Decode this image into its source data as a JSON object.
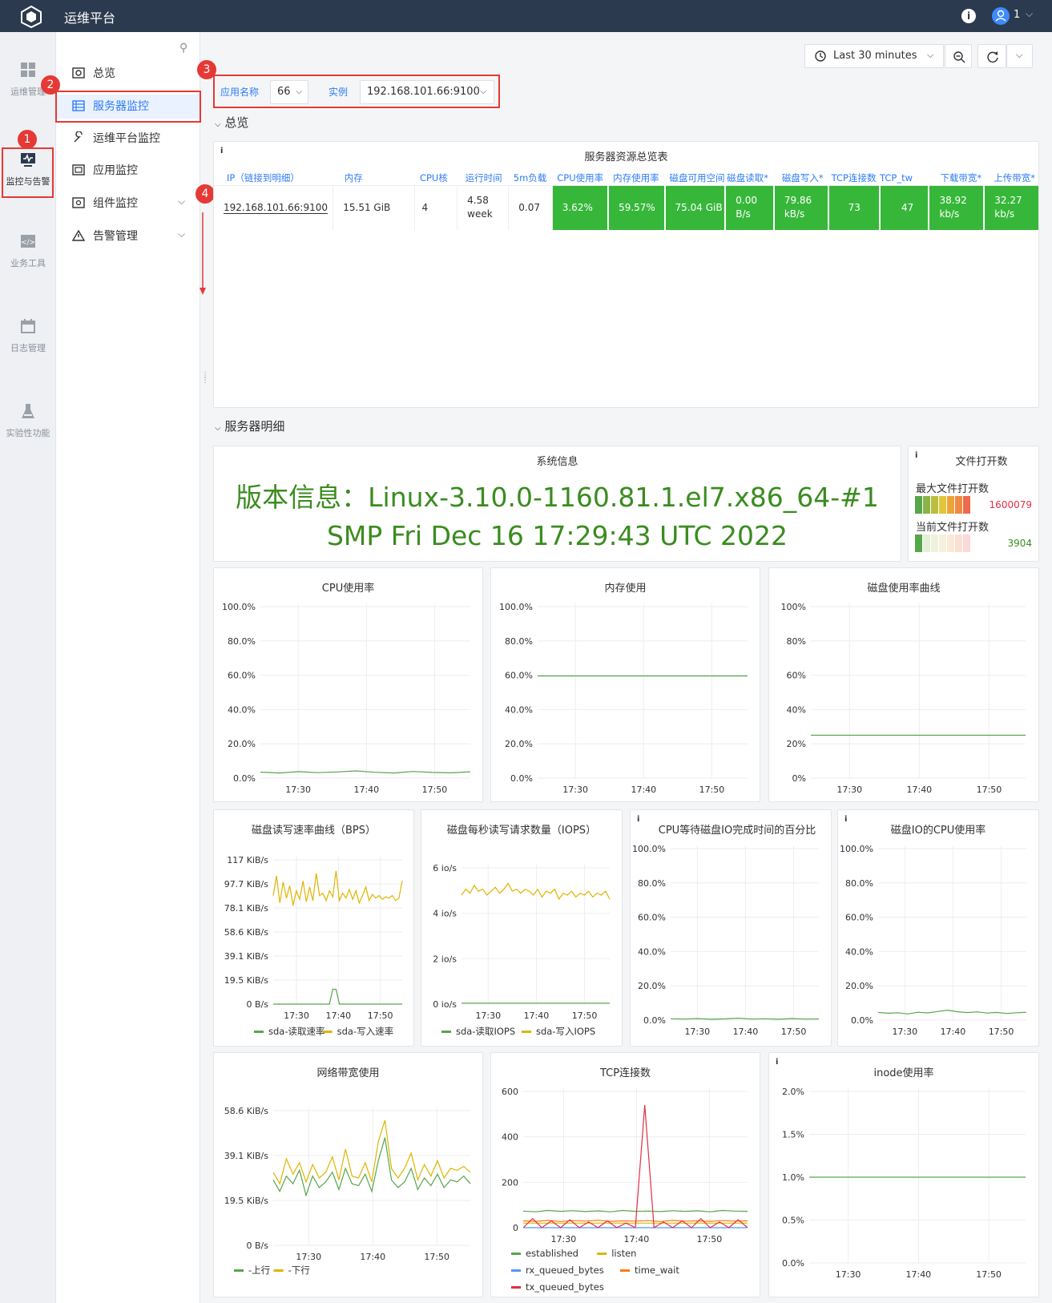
{
  "app": {
    "title": "运维平台",
    "user": "1"
  },
  "rail": [
    {
      "label": "运维管理",
      "icon": "grid-icon"
    },
    {
      "label": "监控与告警",
      "icon": "monitor-icon"
    },
    {
      "label": "业务工具",
      "icon": "code-icon"
    },
    {
      "label": "日志管理",
      "icon": "calendar-icon"
    },
    {
      "label": "实验性功能",
      "icon": "flask-icon"
    }
  ],
  "menu": [
    {
      "label": "总览",
      "icon": "dashboard-icon"
    },
    {
      "label": "服务器监控",
      "icon": "server-list-icon"
    },
    {
      "label": "运维平台监控",
      "icon": "wrench-icon"
    },
    {
      "label": "应用监控",
      "icon": "app-icon"
    },
    {
      "label": "组件监控",
      "icon": "component-icon"
    },
    {
      "label": "告警管理",
      "icon": "alert-icon"
    }
  ],
  "annotations": [
    "1",
    "2",
    "3",
    "4"
  ],
  "time_picker": {
    "label": "Last 30 minutes"
  },
  "filters": {
    "app_label": "应用名称",
    "app_value": "66",
    "instance_label": "实例",
    "instance_value": "192.168.101.66:9100"
  },
  "sections": {
    "overview": "总览",
    "detail": "服务器明细"
  },
  "overview_table": {
    "title": "服务器资源总览表",
    "headers": [
      "IP（链接到明细）",
      "内存",
      "CPU核",
      "运行时间",
      "5m负载",
      "CPU使用率",
      "内存使用率",
      "磁盘可用空间",
      "磁盘读取*",
      "磁盘写入*",
      "TCP连接数",
      "TCP_tw",
      "下载带宽*",
      "上传带宽*"
    ],
    "row": [
      "192.168.101.66:9100",
      "15.51 GiB",
      "4",
      "4.58 week",
      "0.07",
      "3.62%",
      "59.57%",
      "75.04 GiB",
      "0.00 B/s",
      "79.86 kB/s",
      "73",
      "47",
      "38.92 kb/s",
      "32.27 kb/s"
    ]
  },
  "sysinfo": {
    "title": "系统信息",
    "text": "版本信息：Linux-3.10.0-1160.81.1.el7.x86_64-#1 SMP Fri Dec 16 17:29:43 UTC 2022"
  },
  "files": {
    "title": "文件打开数",
    "max_label": "最大文件打开数",
    "max_value": "1600079",
    "cur_label": "当前文件打开数",
    "cur_value": "3904"
  },
  "colors": {
    "green": "#56a64b",
    "yellow": "#e0b400",
    "blue": "#5794f2",
    "orange": "#ff780a",
    "red": "#e02f44",
    "cell_green": "#37b73a"
  },
  "charts": [
    {
      "title": "CPU使用率",
      "yticks": [
        "100.0%",
        "80.0%",
        "60.0%",
        "40.0%",
        "20.0%",
        "0.0%"
      ],
      "xticks": [
        "17:30",
        "17:40",
        "17:50"
      ]
    },
    {
      "title": "内存使用",
      "yticks": [
        "100.0%",
        "80.0%",
        "60.0%",
        "40.0%",
        "20.0%",
        "0.0%"
      ],
      "xticks": [
        "17:30",
        "17:40",
        "17:50"
      ]
    },
    {
      "title": "磁盘使用率曲线",
      "yticks": [
        "100%",
        "80%",
        "60%",
        "40%",
        "20%",
        "0%"
      ],
      "xticks": [
        "17:30",
        "17:40",
        "17:50"
      ]
    },
    {
      "title": "磁盘读写速率曲线（BPS）",
      "yticks": [
        "117 KiB/s",
        "97.7 KiB/s",
        "78.1 KiB/s",
        "58.6 KiB/s",
        "39.1 KiB/s",
        "19.5 KiB/s",
        "0 B/s"
      ],
      "xticks": [
        "17:30",
        "17:40",
        "17:50"
      ],
      "legend": [
        "sda-读取速率",
        "sda-写入速率"
      ]
    },
    {
      "title": "磁盘每秒读写请求数量（IOPS）",
      "yticks": [
        "6 io/s",
        "4 io/s",
        "2 io/s",
        "0 io/s"
      ],
      "xticks": [
        "17:30",
        "17:40",
        "17:50"
      ],
      "legend": [
        "sda-读取IOPS",
        "sda-写入IOPS"
      ]
    },
    {
      "title": "CPU等待磁盘IO完成时间的百分比",
      "yticks": [
        "100.0%",
        "80.0%",
        "60.0%",
        "40.0%",
        "20.0%",
        "0.0%"
      ],
      "xticks": [
        "17:30",
        "17:40",
        "17:50"
      ]
    },
    {
      "title": "磁盘IO的CPU使用率",
      "yticks": [
        "100.0%",
        "80.0%",
        "60.0%",
        "40.0%",
        "20.0%",
        "0.0%"
      ],
      "xticks": [
        "17:30",
        "17:40",
        "17:50"
      ]
    },
    {
      "title": "网络带宽使用",
      "yticks": [
        "58.6 KiB/s",
        "39.1 KiB/s",
        "19.5 KiB/s",
        "0 B/s"
      ],
      "xticks": [
        "17:30",
        "17:40",
        "17:50"
      ],
      "legend": [
        "-上行",
        "-下行"
      ]
    },
    {
      "title": "TCP连接数",
      "yticks": [
        "600",
        "400",
        "200",
        "0"
      ],
      "xticks": [
        "17:30",
        "17:40",
        "17:50"
      ],
      "legend": [
        "established",
        "listen",
        "rx_queued_bytes",
        "time_wait",
        "tx_queued_bytes"
      ]
    },
    {
      "title": "inode使用率",
      "yticks": [
        "2.0%",
        "1.5%",
        "1.0%",
        "0.5%",
        "0.0%"
      ],
      "xticks": [
        "17:30",
        "17:40",
        "17:50"
      ]
    }
  ],
  "chart_data": [
    {
      "type": "line",
      "title": "CPU使用率",
      "ylim": [
        0,
        100
      ],
      "x": [
        "17:22",
        "17:52"
      ],
      "series": [
        {
          "values": [
            3.5,
            3.0,
            3.8,
            3.2,
            3.6,
            4.2,
            3.4,
            3.0,
            3.9,
            3.3,
            3.1,
            3.7
          ]
        }
      ]
    },
    {
      "type": "line",
      "title": "内存使用",
      "ylim": [
        0,
        100
      ],
      "x": [
        "17:22",
        "17:52"
      ],
      "series": [
        {
          "values": [
            59.6,
            59.6
          ]
        }
      ]
    },
    {
      "type": "line",
      "title": "磁盘使用率曲线",
      "ylim": [
        0,
        100
      ],
      "x": [
        "17:22",
        "17:52"
      ],
      "series": [
        {
          "values": [
            25,
            25
          ]
        }
      ]
    },
    {
      "type": "line",
      "title": "磁盘读写速率曲线（BPS）",
      "ylim": [
        0,
        117
      ],
      "legend": "bottom",
      "series": [
        {
          "name": "sda-读取速率",
          "values": [
            0,
            0,
            0,
            0,
            0,
            0,
            0,
            0,
            0,
            0,
            0,
            0,
            0,
            0,
            0,
            0,
            0,
            0,
            12,
            12,
            0,
            0,
            0,
            0,
            0,
            0,
            0,
            0,
            0,
            0,
            0,
            0,
            0,
            0,
            0,
            0,
            0,
            0,
            0,
            0
          ]
        },
        {
          "name": "sda-写入速率",
          "values": [
            88,
            104,
            82,
            99,
            86,
            96,
            80,
            92,
            85,
            100,
            83,
            95,
            84,
            106,
            88,
            90,
            84,
            92,
            87,
            108,
            84,
            90,
            86,
            93,
            85,
            92,
            82,
            88,
            95,
            84,
            89,
            86,
            88,
            85,
            87,
            86,
            88,
            84,
            86,
            100
          ]
        }
      ]
    },
    {
      "type": "line",
      "title": "磁盘每秒读写请求数量（IOPS）",
      "ylim": [
        0,
        7
      ],
      "legend": "bottom",
      "series": [
        {
          "name": "sda-读取IOPS",
          "values": [
            0.05,
            0.05
          ]
        },
        {
          "name": "sda-写入IOPS",
          "values": [
            5.6,
            5.9,
            5.7,
            6.1,
            5.8,
            5.9,
            5.6,
            5.8,
            6.0,
            5.7,
            5.9,
            6.2,
            5.8,
            5.9,
            5.7,
            5.9,
            5.8,
            5.6,
            5.9,
            5.5,
            5.8,
            5.7,
            5.9,
            5.4,
            5.7,
            5.6,
            5.8,
            5.5,
            5.7,
            5.6,
            5.8,
            5.5,
            5.7,
            5.6,
            5.8,
            5.4
          ]
        }
      ]
    },
    {
      "type": "line",
      "title": "CPU等待磁盘IO完成时间的百分比",
      "ylim": [
        0,
        100
      ],
      "series": [
        {
          "values": [
            0.8,
            0.6,
            0.9,
            0.5,
            0.7,
            1.1,
            0.6,
            0.8,
            0.5,
            0.9,
            0.6,
            0.7
          ]
        }
      ]
    },
    {
      "type": "line",
      "title": "磁盘IO的CPU使用率",
      "ylim": [
        0,
        100
      ],
      "series": [
        {
          "values": [
            4.5,
            4.0,
            4.3,
            3.6,
            4.6,
            4.2,
            5.0,
            5.8,
            4.9,
            4.4,
            4.8,
            4.1,
            4.5,
            3.9,
            4.3,
            4.6
          ]
        }
      ]
    },
    {
      "type": "line",
      "title": "网络带宽使用",
      "ylim": [
        0,
        70
      ],
      "legend": "bottom",
      "series": [
        {
          "name": "-上行",
          "values": [
            34,
            28,
            36,
            32,
            39,
            26,
            36,
            30,
            33,
            38,
            29,
            40,
            32,
            31,
            37,
            28,
            44,
            56,
            34,
            30,
            33,
            40,
            29,
            35,
            31,
            37,
            30,
            34,
            33,
            36,
            32
          ]
        },
        {
          "name": "-下行",
          "values": [
            38,
            32,
            45,
            37,
            43,
            33,
            42,
            35,
            38,
            46,
            34,
            50,
            36,
            35,
            43,
            33,
            54,
            65,
            40,
            35,
            40,
            48,
            34,
            42,
            36,
            44,
            35,
            40,
            39,
            41,
            38
          ]
        }
      ]
    },
    {
      "type": "line",
      "title": "TCP连接数",
      "ylim": [
        0,
        600
      ],
      "legend": "bottom",
      "series": [
        {
          "name": "established",
          "values": [
            73,
            70,
            76,
            72,
            75,
            71,
            74,
            70,
            76,
            72,
            73,
            71,
            75,
            72,
            74,
            70,
            76,
            73,
            72
          ]
        },
        {
          "name": "listen",
          "values": [
            20,
            20
          ]
        },
        {
          "name": "rx_queued_bytes",
          "values": [
            0,
            0
          ]
        },
        {
          "name": "time_wait",
          "values": [
            30,
            28,
            32,
            27,
            31,
            29,
            33,
            28,
            30,
            29,
            31,
            27,
            32,
            29,
            30,
            28,
            31,
            29,
            30
          ]
        },
        {
          "name": "tx_queued_bytes",
          "values": [
            0,
            40,
            0,
            30,
            0,
            35,
            0,
            25,
            0,
            30,
            0,
            20,
            0,
            540,
            0,
            25,
            0,
            30,
            0,
            40,
            0,
            25,
            0,
            35,
            0
          ]
        }
      ]
    },
    {
      "type": "line",
      "title": "inode使用率",
      "ylim": [
        0,
        2
      ],
      "series": [
        {
          "values": [
            1.0,
            1.0
          ]
        }
      ]
    }
  ]
}
